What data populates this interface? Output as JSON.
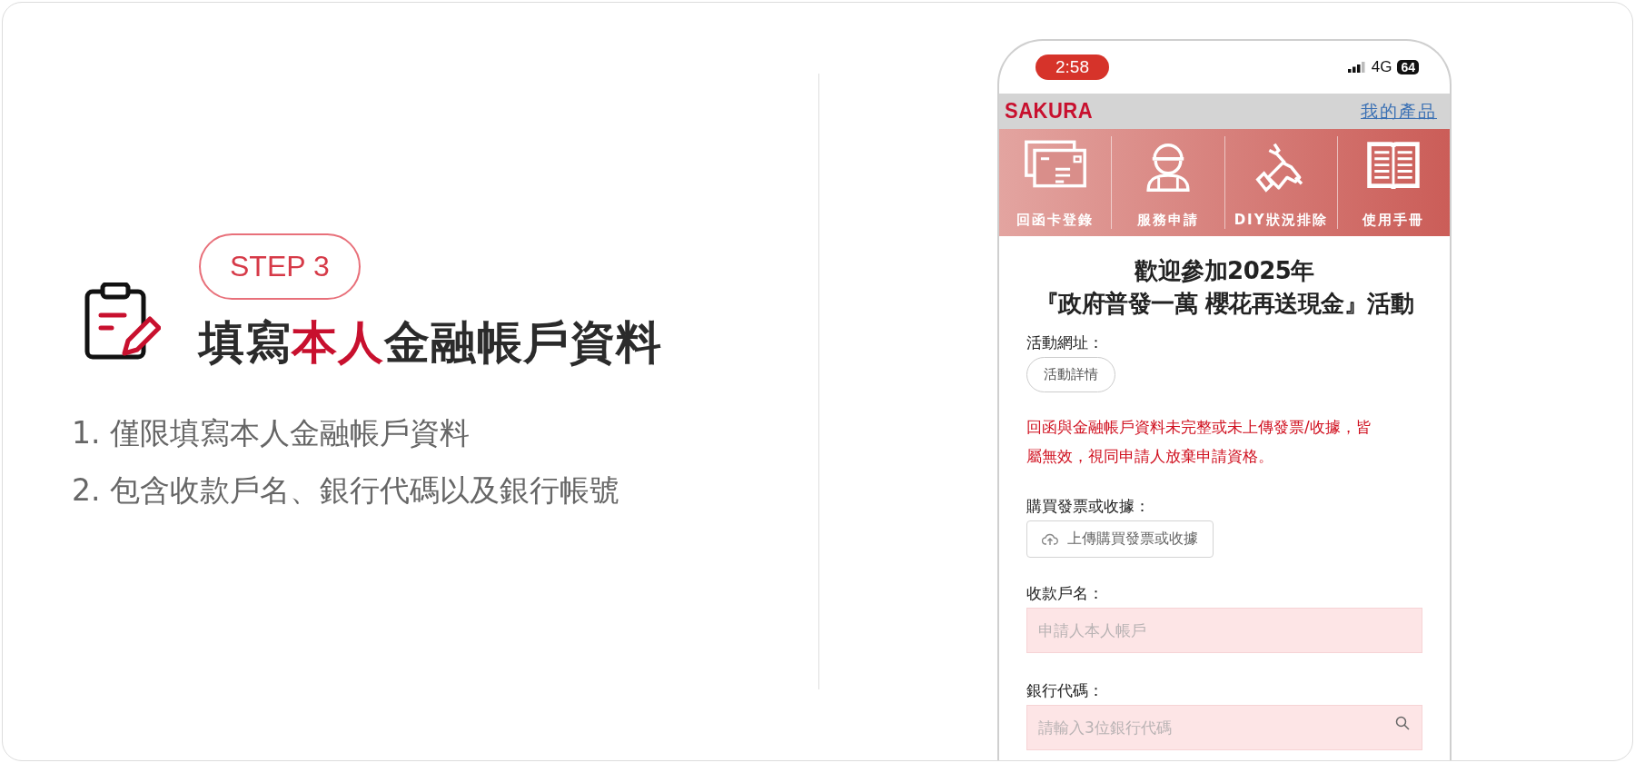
{
  "intro": {
    "badge": "STEP 3",
    "kind": "clipboard",
    "title": [
      {
        "text": "填寫",
        "highlight": false
      },
      {
        "text": "本人",
        "highlight": true
      },
      {
        "text": "金融帳戶資料",
        "highlight": false
      }
    ],
    "notes": [
      "1. 僅限填寫本人金融帳戶資料",
      "2. 包含收款戶名、銀行代碼以及銀行帳號"
    ]
  },
  "phone": {
    "status_bar": {
      "time": "2:58",
      "network": "4G",
      "battery": "64"
    },
    "header": {
      "logo": "SAKURA",
      "link": "我的產品"
    },
    "nav": [
      {
        "label": "回函卡登錄",
        "kind": "envelope"
      },
      {
        "label": "服務申請",
        "kind": "worker"
      },
      {
        "label": "DIY狀況排除",
        "kind": "repair"
      },
      {
        "label": "使用手冊",
        "kind": "book"
      }
    ],
    "form": {
      "title": [
        "歡迎參加2025年",
        "『政府普發一萬 櫻花再送現金』活動"
      ],
      "sections": [
        {
          "kind": "link",
          "label": "活動網址：",
          "button": "活動詳情"
        },
        {
          "kind": "notice",
          "text": "回函與金融帳戶資料未完整或未上傳發票/收據，皆屬無效，視同申請人放棄申請資格。"
        },
        {
          "kind": "upload",
          "label": "購買發票或收據：",
          "button": "上傳購買發票或收據"
        },
        {
          "kind": "field",
          "label": "收款戶名：",
          "placeholder": "申請人本人帳戶"
        },
        {
          "kind": "search",
          "label": "銀行代碼：",
          "placeholder": "請輸入3位銀行代碼"
        }
      ]
    }
  }
}
